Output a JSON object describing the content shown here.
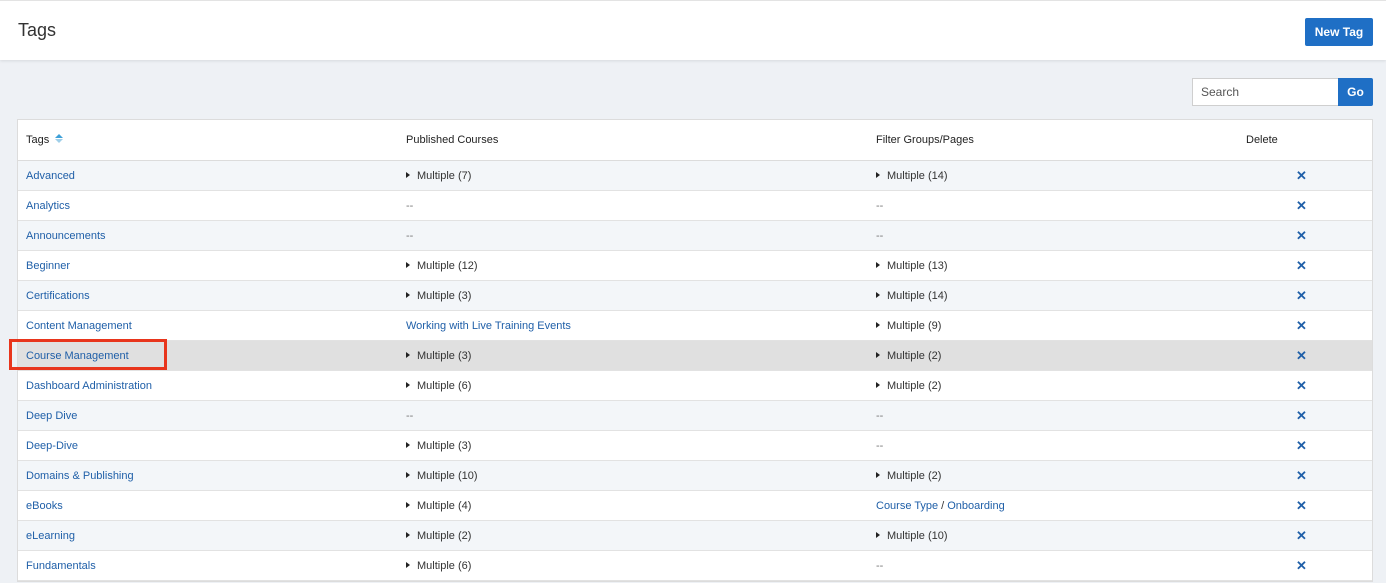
{
  "header": {
    "title": "Tags",
    "new_tag_label": "New Tag"
  },
  "search": {
    "placeholder": "Search",
    "go_label": "Go"
  },
  "colors": {
    "accent": "#1f6fc5",
    "link": "#1f5fa8",
    "highlight": "#e8351c"
  },
  "table": {
    "columns": {
      "tags": "Tags",
      "published_courses": "Published Courses",
      "filter_groups": "Filter Groups/Pages",
      "delete": "Delete"
    },
    "delete_glyph": "✕",
    "rows": [
      {
        "tag": "Advanced",
        "courses": {
          "type": "multiple",
          "text": "Multiple (7)"
        },
        "filters": {
          "type": "multiple",
          "text": "Multiple (14)"
        }
      },
      {
        "tag": "Analytics",
        "courses": {
          "type": "empty",
          "text": "--"
        },
        "filters": {
          "type": "empty",
          "text": "--"
        }
      },
      {
        "tag": "Announcements",
        "courses": {
          "type": "empty",
          "text": "--"
        },
        "filters": {
          "type": "empty",
          "text": "--"
        }
      },
      {
        "tag": "Beginner",
        "courses": {
          "type": "multiple",
          "text": "Multiple (12)"
        },
        "filters": {
          "type": "multiple",
          "text": "Multiple (13)"
        }
      },
      {
        "tag": "Certifications",
        "courses": {
          "type": "multiple",
          "text": "Multiple (3)"
        },
        "filters": {
          "type": "multiple",
          "text": "Multiple (14)"
        }
      },
      {
        "tag": "Content Management",
        "courses": {
          "type": "link",
          "text": "Working with Live Training Events"
        },
        "filters": {
          "type": "multiple",
          "text": "Multiple (9)"
        }
      },
      {
        "tag": "Course Management",
        "courses": {
          "type": "multiple",
          "text": "Multiple (3)"
        },
        "filters": {
          "type": "multiple",
          "text": "Multiple (2)"
        }
      },
      {
        "tag": "Dashboard Administration",
        "courses": {
          "type": "multiple",
          "text": "Multiple (6)"
        },
        "filters": {
          "type": "multiple",
          "text": "Multiple (2)"
        }
      },
      {
        "tag": "Deep Dive",
        "courses": {
          "type": "empty",
          "text": "--"
        },
        "filters": {
          "type": "empty",
          "text": "--"
        }
      },
      {
        "tag": "Deep-Dive",
        "courses": {
          "type": "multiple",
          "text": "Multiple (3)"
        },
        "filters": {
          "type": "empty",
          "text": "--"
        }
      },
      {
        "tag": "Domains & Publishing",
        "courses": {
          "type": "multiple",
          "text": "Multiple (10)"
        },
        "filters": {
          "type": "multiple",
          "text": "Multiple (2)"
        }
      },
      {
        "tag": "eBooks",
        "courses": {
          "type": "multiple",
          "text": "Multiple (4)"
        },
        "filters": {
          "type": "links",
          "parts": [
            "Course Type",
            "Onboarding"
          ],
          "separator": "/"
        }
      },
      {
        "tag": "eLearning",
        "courses": {
          "type": "multiple",
          "text": "Multiple (2)"
        },
        "filters": {
          "type": "multiple",
          "text": "Multiple (10)"
        }
      },
      {
        "tag": "Fundamentals",
        "courses": {
          "type": "multiple",
          "text": "Multiple (6)"
        },
        "filters": {
          "type": "empty",
          "text": "--"
        }
      }
    ]
  }
}
